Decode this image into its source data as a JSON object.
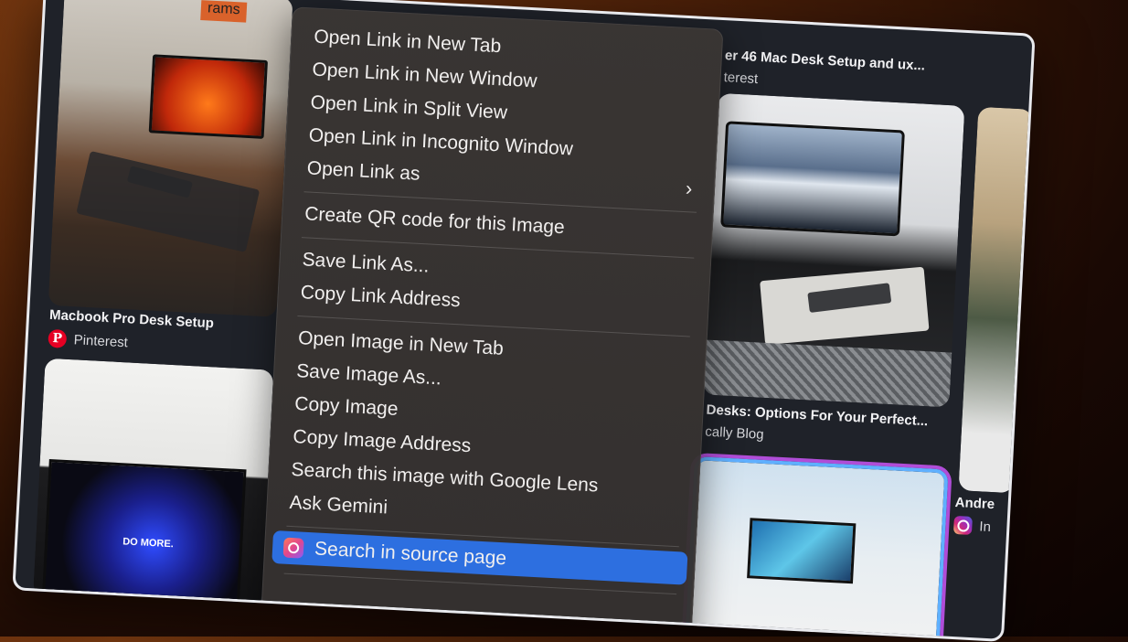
{
  "cards": {
    "left_top": {
      "title": "Macbook Pro Desk Setup",
      "source": "Pinterest",
      "icon": "pinterest-icon",
      "sign_text": "rams"
    },
    "left_bottom": {
      "screen_text": "DO MORE."
    },
    "right_top": {
      "title": "er 46 Mac Desk Setup and ux...",
      "source": "terest"
    },
    "right_mid": {
      "title": "Desks: Options For Your Perfect...",
      "source": "cally Blog"
    },
    "far_right": {
      "title": "Andre",
      "source": "In",
      "icon": "instagram-icon"
    }
  },
  "menu": {
    "items": [
      {
        "label": "Open Link in New Tab"
      },
      {
        "label": "Open Link in New Window"
      },
      {
        "label": "Open Link in Split View"
      },
      {
        "label": "Open Link in Incognito Window"
      },
      {
        "label": "Open Link as",
        "submenu_icon": "chevron-right-icon"
      },
      {
        "label": "Create QR code for this Image"
      },
      {
        "label": "Save Link As..."
      },
      {
        "label": "Copy Link Address"
      },
      {
        "label": "Open Image in New Tab"
      },
      {
        "label": "Save Image As..."
      },
      {
        "label": "Copy Image"
      },
      {
        "label": "Copy Image Address"
      },
      {
        "label": "Search this image with Google Lens"
      },
      {
        "label": "Ask Gemini"
      },
      {
        "label": "Search in source page",
        "highlighted": true,
        "icon": "lens-search-icon"
      }
    ]
  },
  "colors": {
    "highlight": "#2d6fe0",
    "menu_bg": "#3a3634",
    "screen_bg": "#1f2229"
  }
}
